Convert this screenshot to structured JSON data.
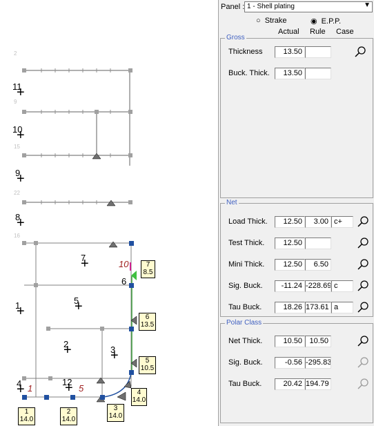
{
  "panel": {
    "label": "Panel :",
    "selected": "1 - Shell plating",
    "radio_strake": "Strake",
    "radio_epp": "E.P.P.",
    "col_actual": "Actual",
    "col_rule": "Rule",
    "col_case": "Case",
    "gross": {
      "title": "Gross",
      "rows": [
        {
          "label": "Thickness",
          "actual": "13.50",
          "rule": ""
        },
        {
          "label": "Buck. Thick.",
          "actual": "13.50",
          "rule": ""
        }
      ]
    },
    "net": {
      "title": "Net",
      "rows": [
        {
          "label": "Load Thick.",
          "actual": "12.50",
          "rule": "3.00",
          "case": "c+"
        },
        {
          "label": "Test Thick.",
          "actual": "12.50",
          "rule": "",
          "case": ""
        },
        {
          "label": "Mini Thick.",
          "actual": "12.50",
          "rule": "6.50",
          "case": ""
        },
        {
          "label": "Sig. Buck.",
          "actual": "-11.24",
          "rule": "-228.69",
          "case": "c"
        },
        {
          "label": "Tau Buck.",
          "actual": "18.26",
          "rule": "173.61",
          "case": "a"
        }
      ]
    },
    "polar": {
      "title": "Polar Class",
      "rows": [
        {
          "label": "Net Thick.",
          "actual": "10.50",
          "rule": "10.50"
        },
        {
          "label": "Sig. Buck.",
          "actual": "-0.56",
          "rule": "-295.83"
        },
        {
          "label": "Tau Buck.",
          "actual": "20.42",
          "rule": "194.79"
        }
      ]
    }
  },
  "drawing": {
    "gridlines": [
      "11",
      "10",
      "9",
      "8",
      "1",
      "4"
    ],
    "panels": [
      "7",
      "5",
      "2",
      "3",
      "6",
      "1",
      "12"
    ],
    "red_labels": [
      "10",
      "1",
      "5"
    ],
    "tags": [
      {
        "n": "7",
        "t": "8.5"
      },
      {
        "n": "6",
        "t": "13.5"
      },
      {
        "n": "5",
        "t": "10.5"
      },
      {
        "n": "4",
        "t": "14.0"
      },
      {
        "n": "3",
        "t": "14.0"
      },
      {
        "n": "1",
        "t": "14.0"
      },
      {
        "n": "2",
        "t": "14.0"
      }
    ]
  }
}
